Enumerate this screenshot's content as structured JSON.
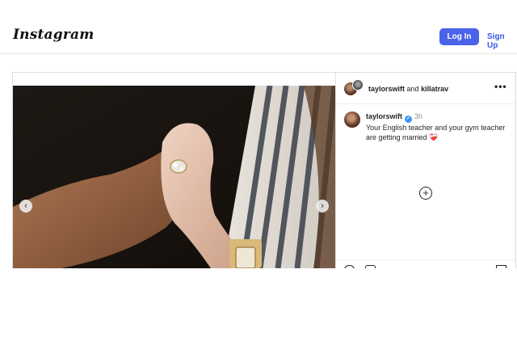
{
  "header": {
    "logo_text": "Instagram",
    "login_label": "Log In",
    "signup_label": "Sign Up"
  },
  "post": {
    "header": {
      "user1": "taylorswift",
      "conjunction": "and",
      "user2": "killatrav",
      "more_icon": "ellipsis-icon"
    },
    "caption": {
      "username": "taylorswift",
      "verified_icon": "verified-badge-icon",
      "time": "3h",
      "text": "Your English teacher and your gym teacher are getting married",
      "emoji": "❤️‍🩹"
    },
    "carousel": {
      "prev_icon": "chevron-left-icon",
      "next_icon": "chevron-right-icon"
    },
    "add_comment_icon": "plus-circle-icon",
    "actions": [
      "heart-icon",
      "comment-icon",
      "bookmark-icon"
    ]
  },
  "colors": {
    "primary_button": "#4a63e8",
    "link": "#3a57e8",
    "verified": "#3897f0"
  }
}
